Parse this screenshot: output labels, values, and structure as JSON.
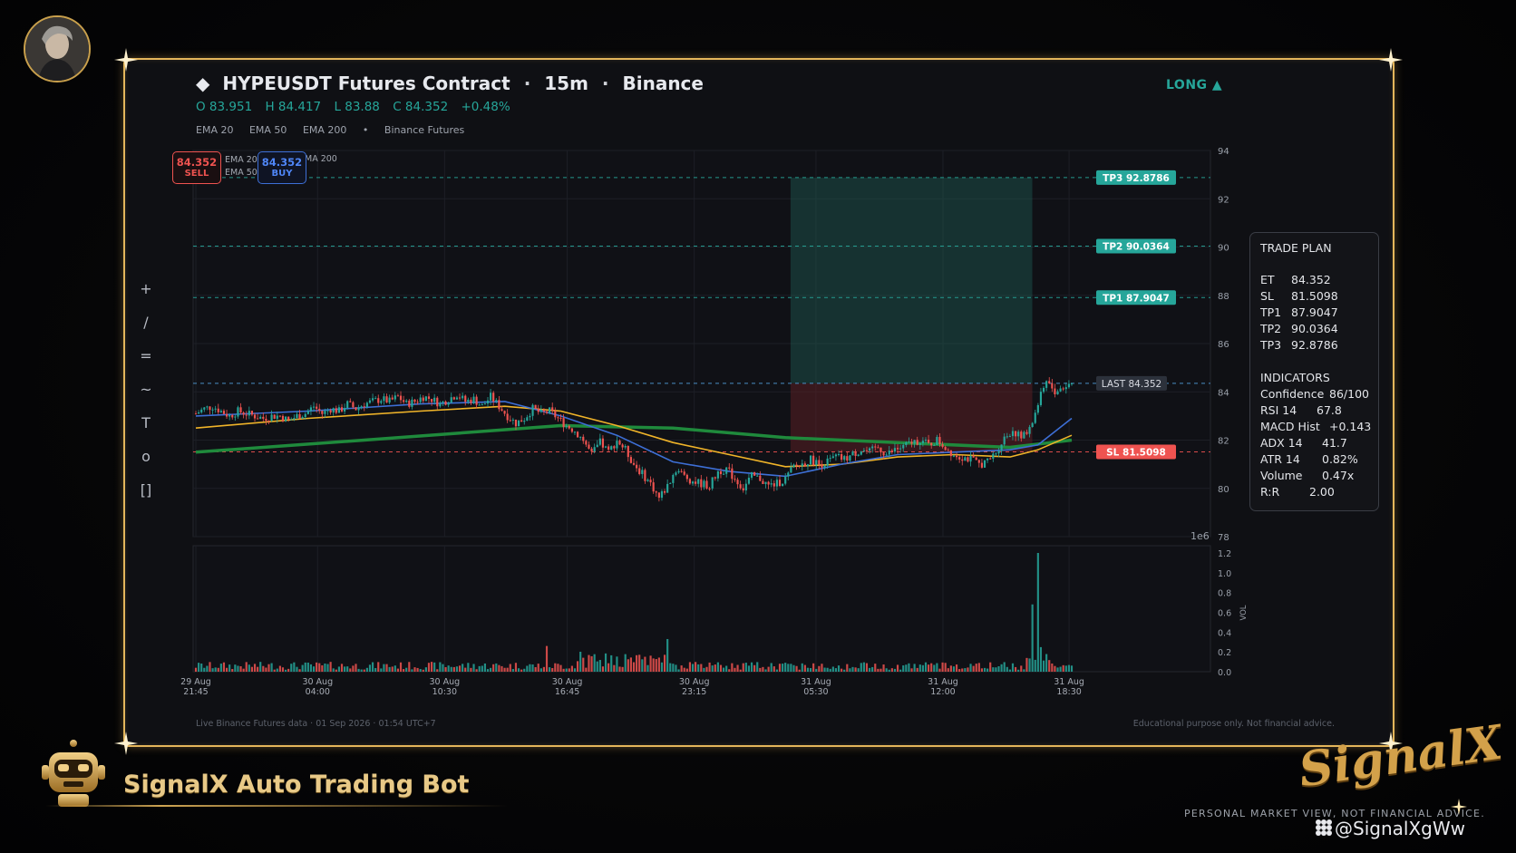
{
  "header": {
    "title": "HYPEUSDT Futures Contract",
    "timeframe": "15m",
    "exchange": "Binance",
    "direction": "LONG ▲",
    "ohlc": {
      "o": "O 83.951",
      "h": "H 84.417",
      "l": "L 83.88",
      "c": "C 84.352",
      "chg": "+0.48%"
    },
    "legend": [
      "EMA 20",
      "EMA 50",
      "EMA 200",
      "•",
      "Binance Futures"
    ]
  },
  "sell_buy": {
    "sell_price": "84.352",
    "sell_label": "SELL",
    "buy_price": "84.352",
    "buy_label": "BUY",
    "inner_legend": [
      "EMA 20",
      "EMA 50",
      "EMA 200"
    ]
  },
  "toolbar": {
    "items": [
      "+",
      "/",
      "=",
      "~",
      "T",
      "o",
      "[]"
    ]
  },
  "chart_data": {
    "type": "candlestick",
    "symbol": "HYPEUSDT",
    "price_axis": {
      "min": 78,
      "max": 94,
      "ticks": [
        78,
        80,
        82,
        84,
        86,
        88,
        90,
        92,
        94
      ],
      "scale_label": "1e6"
    },
    "volume_axis": {
      "min": 0,
      "max": 1.2,
      "ticks": [
        "0.0",
        "0.2",
        "0.4",
        "0.6",
        "0.8",
        "1.0",
        "1.2"
      ],
      "label": "VOL"
    },
    "x_ticks": [
      {
        "date": "29 Aug",
        "time": "21:45",
        "frac": 0.0
      },
      {
        "date": "30 Aug",
        "time": "04:00",
        "frac": 0.139
      },
      {
        "date": "30 Aug",
        "time": "10:30",
        "frac": 0.284
      },
      {
        "date": "30 Aug",
        "time": "16:45",
        "frac": 0.424
      },
      {
        "date": "30 Aug",
        "time": "23:15",
        "frac": 0.569
      },
      {
        "date": "31 Aug",
        "time": "05:30",
        "frac": 0.708
      },
      {
        "date": "31 Aug",
        "time": "12:00",
        "frac": 0.853
      },
      {
        "date": "31 Aug",
        "time": "18:30",
        "frac": 0.997
      }
    ],
    "close_path": [
      [
        0,
        83.1
      ],
      [
        3,
        83.3
      ],
      [
        6,
        83.4
      ],
      [
        9,
        83.2
      ],
      [
        12,
        83.0
      ],
      [
        15,
        83.2
      ],
      [
        18,
        83.1
      ],
      [
        21,
        83.0
      ],
      [
        24,
        82.9
      ],
      [
        27,
        83.0
      ],
      [
        30,
        83.0
      ],
      [
        33,
        82.8
      ],
      [
        36,
        83.0
      ],
      [
        39,
        83.1
      ],
      [
        42,
        83.4
      ],
      [
        45,
        83.1
      ],
      [
        48,
        83.3
      ],
      [
        51,
        83.2
      ],
      [
        54,
        83.5
      ],
      [
        57,
        83.3
      ],
      [
        60,
        83.5
      ],
      [
        63,
        83.6
      ],
      [
        66,
        83.7
      ],
      [
        69,
        83.6
      ],
      [
        72,
        83.8
      ],
      [
        75,
        83.5
      ],
      [
        78,
        83.6
      ],
      [
        81,
        83.8
      ],
      [
        84,
        83.7
      ],
      [
        87,
        83.5
      ],
      [
        90,
        83.7
      ],
      [
        93,
        83.9
      ],
      [
        96,
        83.6
      ],
      [
        99,
        83.7
      ],
      [
        102,
        83.4
      ],
      [
        105,
        83.8
      ],
      [
        108,
        83.4
      ],
      [
        111,
        83.0
      ],
      [
        114,
        82.7
      ],
      [
        117,
        82.9
      ],
      [
        120,
        83.3
      ],
      [
        123,
        83.1
      ],
      [
        126,
        83.2
      ],
      [
        129,
        82.9
      ],
      [
        132,
        82.6
      ],
      [
        135,
        82.4
      ],
      [
        138,
        82.0
      ],
      [
        141,
        81.4
      ],
      [
        144,
        81.9
      ],
      [
        147,
        81.5
      ],
      [
        150,
        82.0
      ],
      [
        153,
        81.6
      ],
      [
        156,
        81.0
      ],
      [
        159,
        80.6
      ],
      [
        162,
        80.2
      ],
      [
        165,
        79.6
      ],
      [
        168,
        80.1
      ],
      [
        171,
        80.8
      ],
      [
        174,
        80.5
      ],
      [
        177,
        80.3
      ],
      [
        180,
        80.2
      ],
      [
        183,
        80.1
      ],
      [
        186,
        80.7
      ],
      [
        189,
        80.8
      ],
      [
        192,
        80.4
      ],
      [
        195,
        80.0
      ],
      [
        198,
        80.5
      ],
      [
        201,
        80.4
      ],
      [
        204,
        80.1
      ],
      [
        207,
        80.2
      ],
      [
        210,
        80.4
      ],
      [
        213,
        80.9
      ],
      [
        216,
        81.0
      ],
      [
        219,
        81.2
      ],
      [
        222,
        81.0
      ],
      [
        225,
        81.1
      ],
      [
        228,
        81.3
      ],
      [
        231,
        81.2
      ],
      [
        234,
        81.4
      ],
      [
        237,
        81.6
      ],
      [
        240,
        81.5
      ],
      [
        243,
        81.7
      ],
      [
        246,
        81.4
      ],
      [
        249,
        81.6
      ],
      [
        252,
        81.7
      ],
      [
        255,
        81.9
      ],
      [
        258,
        82.0
      ],
      [
        261,
        81.8
      ],
      [
        264,
        82.0
      ],
      [
        267,
        81.7
      ],
      [
        270,
        81.4
      ],
      [
        273,
        81.3
      ],
      [
        276,
        81.2
      ],
      [
        279,
        81.0
      ],
      [
        282,
        81.1
      ],
      [
        285,
        81.5
      ],
      [
        288,
        82.1
      ],
      [
        291,
        82.4
      ],
      [
        294,
        82.1
      ],
      [
        297,
        82.4
      ],
      [
        300,
        83.5
      ],
      [
        303,
        84.5
      ],
      [
        306,
        84.0
      ],
      [
        309,
        84.2
      ],
      [
        312,
        84.35
      ]
    ],
    "ema20_path": [
      [
        0,
        83.0
      ],
      [
        40,
        83.2
      ],
      [
        80,
        83.5
      ],
      [
        110,
        83.6
      ],
      [
        130,
        83.0
      ],
      [
        150,
        82.2
      ],
      [
        170,
        81.1
      ],
      [
        190,
        80.7
      ],
      [
        210,
        80.5
      ],
      [
        230,
        81.0
      ],
      [
        250,
        81.4
      ],
      [
        270,
        81.5
      ],
      [
        290,
        81.6
      ],
      [
        300,
        81.8
      ],
      [
        312,
        82.9
      ]
    ],
    "ema50_path": [
      [
        0,
        82.5
      ],
      [
        40,
        82.9
      ],
      [
        80,
        83.2
      ],
      [
        110,
        83.4
      ],
      [
        130,
        83.2
      ],
      [
        150,
        82.6
      ],
      [
        170,
        81.9
      ],
      [
        190,
        81.4
      ],
      [
        210,
        80.9
      ],
      [
        230,
        81.0
      ],
      [
        250,
        81.3
      ],
      [
        270,
        81.4
      ],
      [
        290,
        81.3
      ],
      [
        300,
        81.6
      ],
      [
        312,
        82.2
      ]
    ],
    "ema200_path": [
      [
        0,
        81.5
      ],
      [
        60,
        82.0
      ],
      [
        130,
        82.6
      ],
      [
        170,
        82.5
      ],
      [
        210,
        82.1
      ],
      [
        250,
        81.9
      ],
      [
        290,
        81.7
      ],
      [
        312,
        82.0
      ]
    ],
    "levels": [
      {
        "name": "TP3",
        "value": "92.8786",
        "price": 92.8786,
        "color": "#26a69a"
      },
      {
        "name": "TP2",
        "value": "90.0364",
        "price": 90.0364,
        "color": "#26a69a"
      },
      {
        "name": "TP1",
        "value": "87.9047",
        "price": 87.9047,
        "color": "#26a69a"
      },
      {
        "name": "LAST",
        "value": "84.352",
        "price": 84.352,
        "color": "#4f9bd6"
      },
      {
        "name": "SL",
        "value": "81.5098",
        "price": 81.5098,
        "color": "#ef5350"
      }
    ],
    "position_box": {
      "start_frac": 0.679,
      "end_frac": 0.955,
      "entry": 84.352,
      "sl": 81.5098,
      "tp": 92.8786
    }
  },
  "trade_plan": {
    "title": "TRADE PLAN",
    "rows": [
      {
        "k": "ET",
        "v": "84.352"
      },
      {
        "k": "SL",
        "v": "81.5098"
      },
      {
        "k": "TP1",
        "v": "87.9047"
      },
      {
        "k": "TP2",
        "v": "90.0364"
      },
      {
        "k": "TP3",
        "v": "92.8786"
      }
    ],
    "ind_title": "INDICATORS",
    "indicators": [
      {
        "k": "Confidence",
        "v": "86/100"
      },
      {
        "k": "RSI 14",
        "v": "67.8"
      },
      {
        "k": "MACD Hist",
        "v": "+0.143"
      },
      {
        "k": "ADX 14",
        "v": "41.7"
      },
      {
        "k": "ATR 14",
        "v": "0.82%"
      },
      {
        "k": "Volume",
        "v": "0.47x"
      },
      {
        "k": "R:R",
        "v": "2.00"
      }
    ]
  },
  "footer": {
    "left": "Live Binance Futures data  ·  01 Sep 2026 · 01:54 UTC+7",
    "right": "Educational purpose only. Not financial advice."
  },
  "branding": {
    "bot_name": "SignalX Auto Trading Bot",
    "logo_text": "SignalX",
    "disclaimer": "PERSONAL MARKET VIEW, NOT FINANCIAL ADVICE.",
    "watermark": "@SignalXgWw"
  },
  "colors": {
    "gold": "#e4b65b",
    "up": "#26a69a",
    "down": "#ef5350",
    "ema20": "#3d6fd6",
    "ema50": "#f0b429",
    "ema200": "#1f8a3c"
  }
}
